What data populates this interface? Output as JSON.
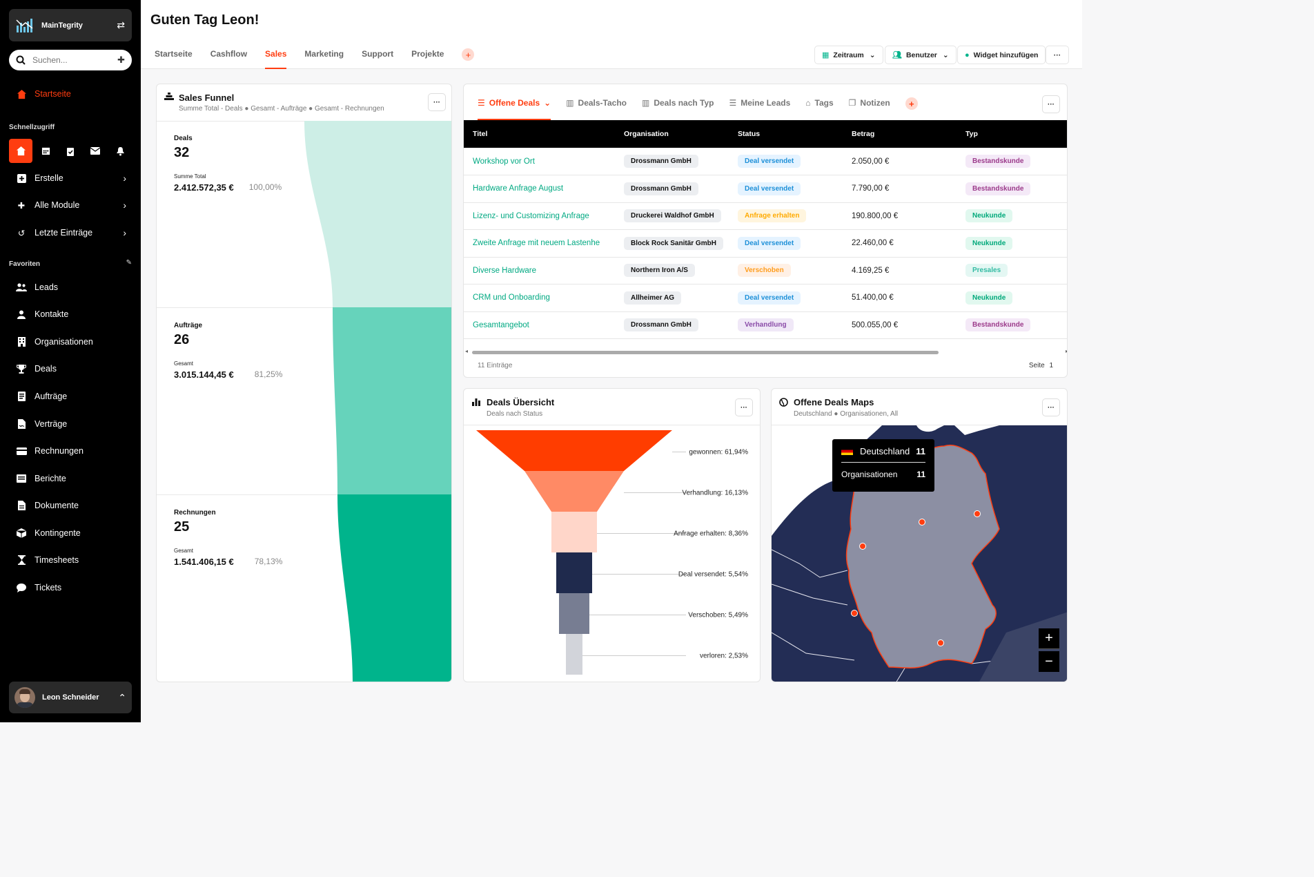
{
  "app": {
    "name": "MainTegrity"
  },
  "search": {
    "placeholder": "Suchen..."
  },
  "sidebar": {
    "home": "Startseite",
    "quick_header": "Schnellzugriff",
    "create": "Erstelle",
    "modules": "Alle Module",
    "recent": "Letzte Einträge",
    "fav_header": "Favoriten",
    "favorites": [
      "Leads",
      "Kontakte",
      "Organisationen",
      "Deals",
      "Aufträge",
      "Verträge",
      "Rechnungen",
      "Berichte",
      "Dokumente",
      "Kontingente",
      "Timesheets",
      "Tickets"
    ]
  },
  "user": {
    "name": "Leon Schneider"
  },
  "header": {
    "greeting": "Guten Tag Leon!",
    "tabs": [
      "Startseite",
      "Cashflow",
      "Sales",
      "Marketing",
      "Support",
      "Projekte"
    ],
    "active_tab": "Sales",
    "btn_period": "Zeitraum",
    "btn_user": "Benutzer",
    "btn_widget": "Widget hinzufügen"
  },
  "funnel": {
    "title": "Sales Funnel",
    "sub1": "Summe Total - Deals",
    "sub2": "Gesamt - Aufträge",
    "sub3": "Gesamt - Rechnungen",
    "stages": [
      {
        "label": "Deals",
        "count": "32",
        "sum_label": "Summe Total",
        "sum": "2.412.572,35 €",
        "pct": "100,00%"
      },
      {
        "label": "Aufträge",
        "count": "26",
        "sum_label": "Gesamt",
        "sum": "3.015.144,45 €",
        "pct": "81,25%"
      },
      {
        "label": "Rechnungen",
        "count": "25",
        "sum_label": "Gesamt",
        "sum": "1.541.406,15 €",
        "pct": "78,13%"
      }
    ],
    "colors": [
      "#cdeee6",
      "#66d3bb",
      "#00b48c"
    ]
  },
  "deals": {
    "tabs": [
      "Offene Deals",
      "Deals-Tacho",
      "Deals nach Typ",
      "Meine Leads",
      "Tags",
      "Notizen"
    ],
    "columns": [
      "Titel",
      "Organisation",
      "Status",
      "Betrag",
      "Typ"
    ],
    "rows": [
      {
        "t": "Workshop vor Ort",
        "o": "Drossmann GmbH",
        "s": "Deal versendet",
        "b": "2.050,00 €",
        "ty": "Bestandskunde"
      },
      {
        "t": "Hardware Anfrage August",
        "o": "Drossmann GmbH",
        "s": "Deal versendet",
        "b": "7.790,00 €",
        "ty": "Bestandskunde"
      },
      {
        "t": "Lizenz- und Customizing Anfrage",
        "o": "Druckerei Waldhof GmbH",
        "s": "Anfrage erhalten",
        "b": "190.800,00 €",
        "ty": "Neukunde"
      },
      {
        "t": "Zweite Anfrage mit neuem Lastenhe",
        "o": "Block Rock Sanitär GmbH",
        "s": "Deal versendet",
        "b": "22.460,00 €",
        "ty": "Neukunde"
      },
      {
        "t": "Diverse Hardware",
        "o": "Northern Iron A/S",
        "s": "Verschoben",
        "b": "4.169,25 €",
        "ty": "Presales"
      },
      {
        "t": "CRM und Onboarding",
        "o": "Allheimer AG",
        "s": "Deal versendet",
        "b": "51.400,00 €",
        "ty": "Neukunde"
      },
      {
        "t": "Gesamtangebot",
        "o": "Drossmann GmbH",
        "s": "Verhandlung",
        "b": "500.055,00 €",
        "ty": "Bestandskunde"
      }
    ],
    "count": "11 Einträge",
    "page_label": "Seite",
    "page": "1"
  },
  "overview": {
    "title": "Deals Übersicht",
    "sub": "Deals nach Status",
    "chart_data": {
      "type": "funnel",
      "categories": [
        "gewonnen",
        "Verhandlung",
        "Anfrage erhalten",
        "Deal versendet",
        "Verschoben",
        "verloren"
      ],
      "labels": [
        "gewonnen: 61,94%",
        "Verhandlung: 16,13%",
        "Anfrage erhalten: 8,36%",
        "Deal versendet: 5,54%",
        "Verschoben: 5,49%",
        "verloren: 2,53%"
      ],
      "values": [
        61.94,
        16.13,
        8.36,
        5.54,
        5.49,
        2.53
      ],
      "colors": [
        "#ff3d00",
        "#ff8a65",
        "#ffd6c9",
        "#1f2a4d",
        "#777d92",
        "#d2d4da"
      ]
    }
  },
  "map": {
    "title": "Offene Deals Maps",
    "sub1": "Deutschland",
    "sub2": "Organisationen, All",
    "tooltip_country": "Deutschland",
    "tooltip_country_val": "11",
    "tooltip_org": "Organisationen",
    "tooltip_org_val": "11"
  }
}
